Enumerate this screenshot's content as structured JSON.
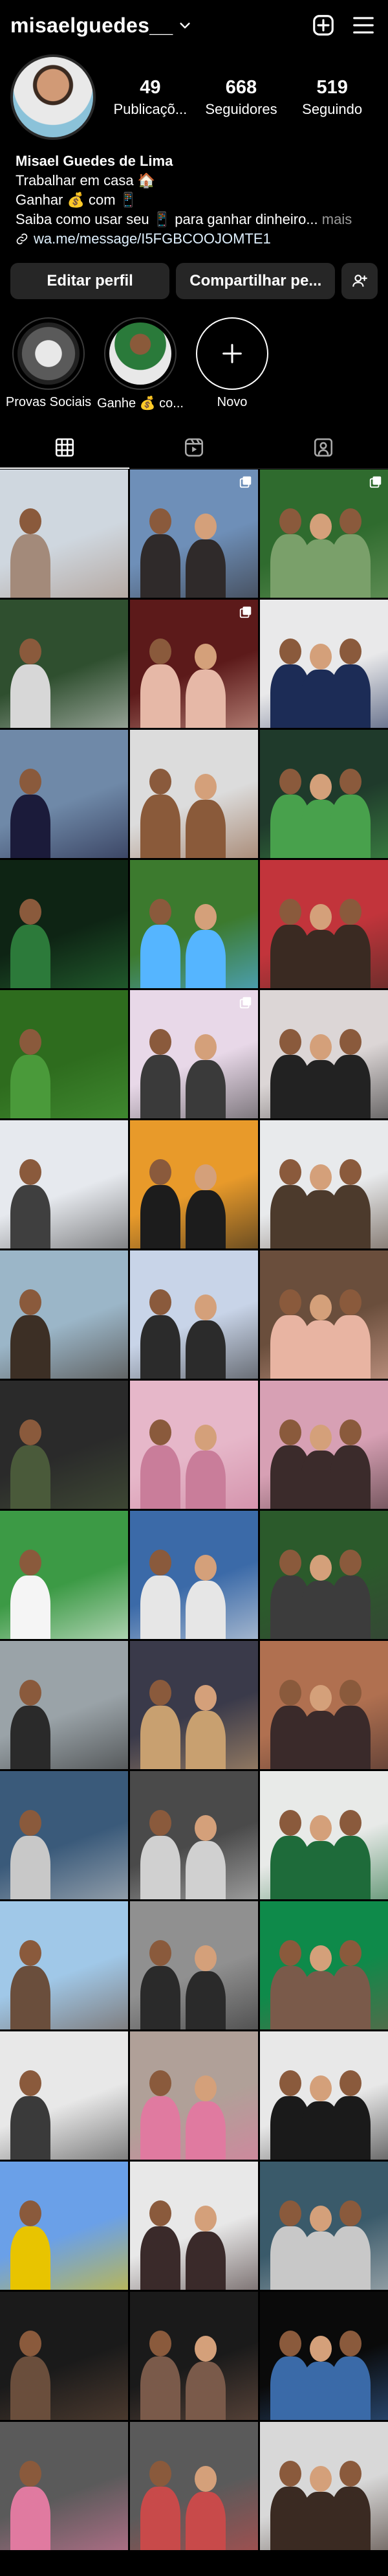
{
  "header": {
    "username": "misaelguedes__",
    "icons": [
      "chevron-down-icon",
      "new-post-icon",
      "menu-icon"
    ]
  },
  "profile": {
    "stats": [
      {
        "value": "49",
        "label": "Publicaçõ..."
      },
      {
        "value": "668",
        "label": "Seguidores"
      },
      {
        "value": "519",
        "label": "Seguindo"
      }
    ],
    "name": "Misael Guedes de Lima",
    "bio_lines": [
      "Trabalhar em casa 🏠",
      "Ganhar 💰 com 📱",
      "Saiba como usar seu 📱 para ganhar dinheiro..."
    ],
    "more_label": "mais",
    "link": "wa.me/message/I5FGBCOOJOMTE1"
  },
  "buttons": {
    "edit": "Editar perfil",
    "share": "Compartilhar pe...",
    "add_user_icon": "add-user-icon"
  },
  "highlights": [
    {
      "label": "Provas Sociais",
      "color": "#4a4a4a"
    },
    {
      "label": "Ganhe 💰 co...",
      "color": "#3d3d3d"
    },
    {
      "label": "Novo",
      "color": "#000000"
    }
  ],
  "tabs": [
    {
      "name": "grid",
      "icon": "grid-icon",
      "active": true
    },
    {
      "name": "reels",
      "icon": "reels-icon",
      "active": false
    },
    {
      "name": "tagged",
      "icon": "tagged-icon",
      "active": false
    }
  ],
  "grid_posts": [
    {
      "bg": "#cfd7df",
      "accent": "#a38a7a",
      "badge": ""
    },
    {
      "bg": "#6e8fb8",
      "accent": "#2f2a2a",
      "badge": "carousel-icon"
    },
    {
      "bg": "#2f6b2e",
      "accent": "#7aa06a",
      "badge": "carousel-icon"
    },
    {
      "bg": "#2f4f2f",
      "accent": "#d7d7d7",
      "badge": ""
    },
    {
      "bg": "#5c1a1a",
      "accent": "#e6b8a7",
      "badge": "carousel-icon"
    },
    {
      "bg": "#e9e9ea",
      "accent": "#1c2c56",
      "badge": ""
    },
    {
      "bg": "#6f89a8",
      "accent": "#1b1b3a",
      "badge": ""
    },
    {
      "bg": "#dcdcdc",
      "accent": "#8a5a3a",
      "badge": ""
    },
    {
      "bg": "#1f3a2b",
      "accent": "#48a14c",
      "badge": ""
    },
    {
      "bg": "#0e2414",
      "accent": "#2c7a3a",
      "badge": ""
    },
    {
      "bg": "#3c7a2e",
      "accent": "#55b5ff",
      "badge": ""
    },
    {
      "bg": "#c2343b",
      "accent": "#3a2a22",
      "badge": ""
    },
    {
      "bg": "#2e6c1e",
      "accent": "#4a9a3a",
      "badge": ""
    },
    {
      "bg": "#e8d8e8",
      "accent": "#3a3a3a",
      "badge": "carousel-icon"
    },
    {
      "bg": "#dcd6d6",
      "accent": "#222222",
      "badge": ""
    },
    {
      "bg": "#e6e9ee",
      "accent": "#3f3f3f",
      "badge": ""
    },
    {
      "bg": "#e89a2a",
      "accent": "#1c1c1c",
      "badge": ""
    },
    {
      "bg": "#e8eaec",
      "accent": "#4c3a2c",
      "badge": ""
    },
    {
      "bg": "#9bb6c8",
      "accent": "#3c2f25",
      "badge": ""
    },
    {
      "bg": "#c8d4e8",
      "accent": "#2b2b2b",
      "badge": ""
    },
    {
      "bg": "#6a4e3c",
      "accent": "#e8b4a2",
      "badge": ""
    },
    {
      "bg": "#2a2a2a",
      "accent": "#4a5a3a",
      "badge": ""
    },
    {
      "bg": "#e6b7c9",
      "accent": "#c97d9a",
      "badge": ""
    },
    {
      "bg": "#d7a0b4",
      "accent": "#3b2b2b",
      "badge": ""
    },
    {
      "bg": "#3c9a45",
      "accent": "#f5f5f5",
      "badge": ""
    },
    {
      "bg": "#3b6aa8",
      "accent": "#e6e6e6",
      "badge": ""
    },
    {
      "bg": "#2b5a2b",
      "accent": "#3c3c3c",
      "badge": ""
    },
    {
      "bg": "#9aa3a8",
      "accent": "#2a2a2a",
      "badge": ""
    },
    {
      "bg": "#3a3a4a",
      "accent": "#c8a070",
      "badge": ""
    },
    {
      "bg": "#b07050",
      "accent": "#3a2a2a",
      "badge": ""
    },
    {
      "bg": "#3a5a7a",
      "accent": "#c8c8c8",
      "badge": ""
    },
    {
      "bg": "#4a4a4a",
      "accent": "#d0d0d0",
      "badge": ""
    },
    {
      "bg": "#e8eae8",
      "accent": "#1e6b3a",
      "badge": ""
    },
    {
      "bg": "#a0c8e8",
      "accent": "#6a4e3c",
      "badge": ""
    },
    {
      "bg": "#909090",
      "accent": "#2a2a2a",
      "badge": ""
    },
    {
      "bg": "#0e8a4a",
      "accent": "#7a5a4a",
      "badge": ""
    },
    {
      "bg": "#e8e8e8",
      "accent": "#3a3a3a",
      "badge": ""
    },
    {
      "bg": "#b0a098",
      "accent": "#e07aa0",
      "badge": ""
    },
    {
      "bg": "#e8e8e8",
      "accent": "#1a1a1a",
      "badge": ""
    },
    {
      "bg": "#6aa0e8",
      "accent": "#e8c400",
      "badge": ""
    },
    {
      "bg": "#e8e8e8",
      "accent": "#3a2a2a",
      "badge": ""
    },
    {
      "bg": "#3a5a6a",
      "accent": "#c8c8c8",
      "badge": ""
    },
    {
      "bg": "#1a1a1a",
      "accent": "#6a4e3c",
      "badge": ""
    },
    {
      "bg": "#1a1a1a",
      "accent": "#7a5a4a",
      "badge": ""
    },
    {
      "bg": "#0a0a0a",
      "accent": "#3a6aa8",
      "badge": ""
    },
    {
      "bg": "#5a5a5a",
      "accent": "#e07aa0",
      "badge": ""
    },
    {
      "bg": "#5a5a5a",
      "accent": "#c84a4a",
      "badge": ""
    },
    {
      "bg": "#d8d8d8",
      "accent": "#3a2a22",
      "badge": ""
    }
  ]
}
